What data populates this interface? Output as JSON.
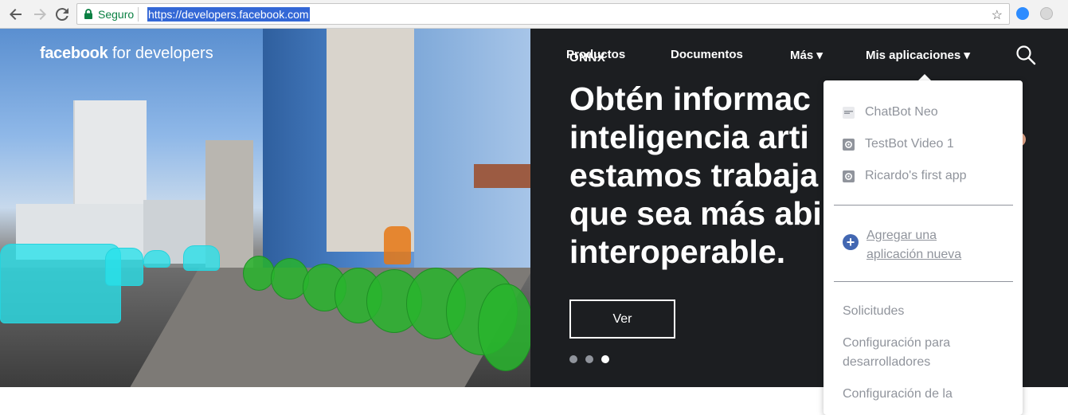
{
  "browser": {
    "secure_label": "Seguro",
    "url": "https://developers.facebook.com",
    "icons": [
      "back-icon",
      "forward-icon",
      "reload-icon",
      "lock-icon",
      "star-icon"
    ]
  },
  "site": {
    "brand_bold": "facebook",
    "brand_light": " for developers",
    "nav": {
      "productos": "Productos",
      "documentos": "Documentos",
      "mas": "Más ▾",
      "mis_apps": "Mis aplicaciones ▾"
    }
  },
  "hero": {
    "overlay_label": "ONNX",
    "headline": [
      "Obtén informac",
      "inteligencia arti",
      "estamos trabaja",
      "que sea más abi",
      "interoperable."
    ],
    "cta": "Ver",
    "dots": 3,
    "active_dot": 3
  },
  "dropdown": {
    "apps": [
      {
        "name": "ChatBot Neo"
      },
      {
        "name": "TestBot Video 1"
      },
      {
        "name": "Ricardo's first app"
      }
    ],
    "add_app": "Agregar una aplicación nueva",
    "links": [
      "Solicitudes",
      "Configuración para desarrolladores",
      "Configuración de la"
    ]
  },
  "colors": {
    "hero_bg": "#1c1e21",
    "link_gray": "#90949c",
    "accent": "#4267b2",
    "url_highlight": "#3367d6",
    "secure_green": "#0b8043"
  }
}
